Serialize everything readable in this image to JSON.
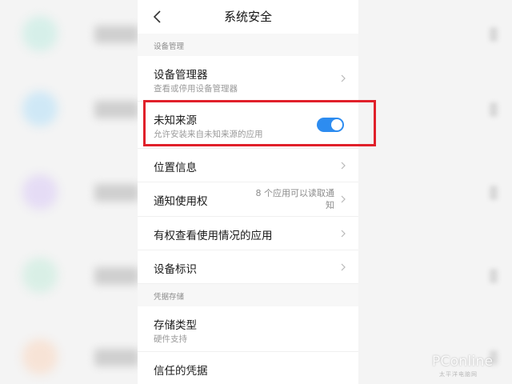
{
  "header": {
    "title": "系统安全"
  },
  "sections": {
    "device_management_label": "设备管理",
    "credential_storage_label": "凭据存储"
  },
  "rows": {
    "device_admin": {
      "title": "设备管理器",
      "subtitle": "查看或停用设备管理器"
    },
    "unknown_sources": {
      "title": "未知来源",
      "subtitle": "允许安装来自未知来源的应用",
      "toggle_on": true
    },
    "location": {
      "title": "位置信息"
    },
    "notification_access": {
      "title": "通知使用权",
      "value_line1": "8 个应用可以读取通",
      "value_line2": "知"
    },
    "usage_access": {
      "title": "有权查看使用情况的应用"
    },
    "device_id": {
      "title": "设备标识"
    },
    "storage_type": {
      "title": "存储类型",
      "subtitle": "硬件支持"
    },
    "trusted_credentials": {
      "title": "信任的凭据"
    }
  },
  "background_icon_colors": [
    "#d6efe9",
    "#cfe8f6",
    "#e5dcf5",
    "#d9efe6",
    "#f7e3d6"
  ],
  "toggle_color": "#2d8cf0",
  "highlight_color": "#e0202a",
  "icons": [
    "back-arrow-icon",
    "chevron-right-icon",
    "toggle-switch"
  ],
  "watermark": {
    "brand": "PConline",
    "sub": "太平洋电脑网"
  }
}
